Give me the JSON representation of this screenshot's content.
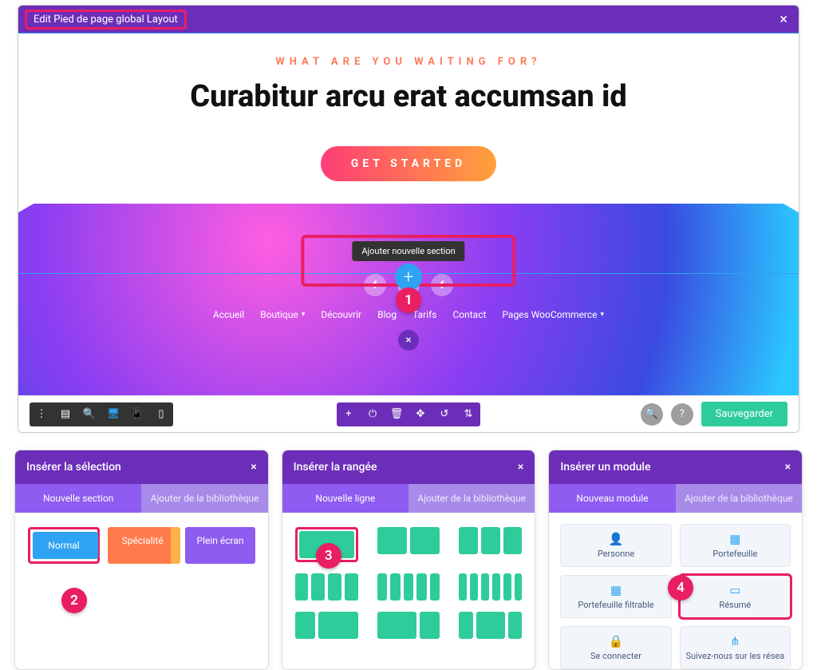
{
  "editor": {
    "title": "Edit Pied de page global Layout",
    "section_tools": [
      "+",
      "✥",
      "◧",
      "⟳",
      "🗑",
      "⋮"
    ],
    "eyebrow": "WHAT ARE YOU WAITING FOR?",
    "headline": "Curabitur arcu erat accumsan id",
    "cta": "GET STARTED",
    "add_section_tooltip": "Ajouter nouvelle section",
    "socials": [
      "f",
      "✦",
      "f"
    ],
    "nav": [
      "Accueil",
      "Boutique",
      "Découvrir",
      "Blog",
      "Tarifs",
      "Contact",
      "Pages WooCommerce"
    ],
    "nav_has_chevron": [
      false,
      true,
      false,
      false,
      false,
      false,
      true
    ],
    "bottombar_left": [
      "⋮",
      "▤",
      "🔍",
      "🖥",
      "📱",
      "▯"
    ],
    "bottombar_center": [
      "+",
      "⏻",
      "🗑",
      "✥",
      "↺",
      "⇅"
    ],
    "help": "?",
    "search": "🔍",
    "save": "Sauvegarder"
  },
  "steps": {
    "s1": "1",
    "s2": "2",
    "s3": "3",
    "s4": "4"
  },
  "modal_section": {
    "title": "Insérer la sélection",
    "tab_a": "Nouvelle section",
    "tab_b": "Ajouter de la bibliothèque",
    "btn_normal": "Normal",
    "btn_spec": "Spécialité",
    "btn_full": "Plein écran"
  },
  "modal_row": {
    "title": "Insérer la rangée",
    "tab_a": "Nouvelle ligne",
    "tab_b": "Ajouter de la bibliothèque",
    "layouts": [
      1,
      2,
      3,
      4,
      5,
      6,
      2,
      2,
      2
    ]
  },
  "modal_module": {
    "title": "Insérer un module",
    "tab_a": "Nouveau module",
    "tab_b": "Ajouter de la bibliothèque",
    "items": [
      {
        "icon": "👤",
        "label": "Personne"
      },
      {
        "icon": "▦",
        "label": "Portefeuille"
      },
      {
        "icon": "▦",
        "label": "Portefeuille filtrable"
      },
      {
        "icon": "▭",
        "label": "Résumé"
      },
      {
        "icon": "🔒",
        "label": "Se connecter"
      },
      {
        "icon": "⋔",
        "label": "Suivez-nous sur les résea"
      }
    ]
  }
}
